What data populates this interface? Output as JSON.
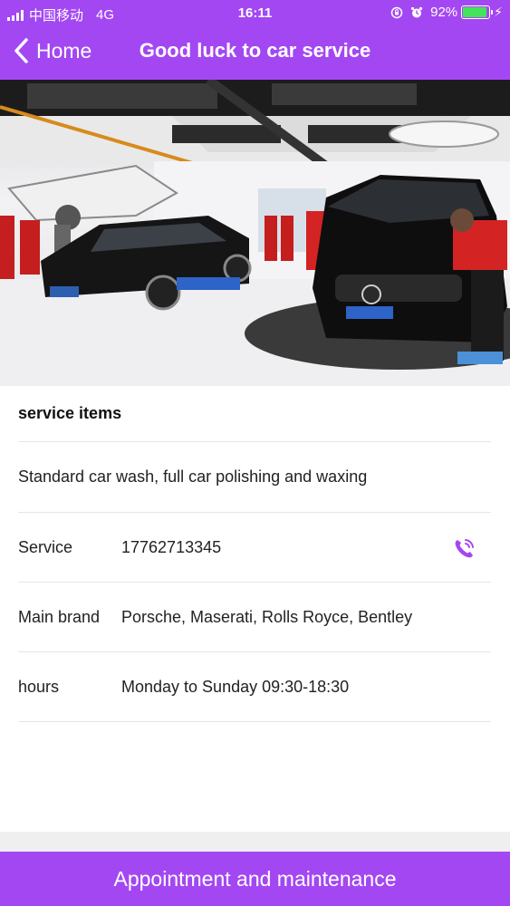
{
  "status_bar": {
    "carrier": "中国移动",
    "network": "4G",
    "time": "16:11",
    "battery_percent": "92%",
    "battery_level": 0.92
  },
  "nav": {
    "back_label": "Home",
    "title": "Good luck to car service"
  },
  "hero": {
    "description_icon": "car-service-photo"
  },
  "info": {
    "section_title": "service items",
    "description": "Standard car wash, full car polishing and waxing",
    "rows": [
      {
        "label": "Service",
        "value": "17762713345"
      },
      {
        "label": "Main brand",
        "value": "Porsche, Maserati, Rolls Royce, Bentley"
      },
      {
        "label": "hours",
        "value": "Monday to Sunday 09:30-18:30"
      }
    ]
  },
  "cta": {
    "label": "Appointment and maintenance"
  },
  "colors": {
    "accent": "#a347f3",
    "battery": "#43e45a"
  }
}
